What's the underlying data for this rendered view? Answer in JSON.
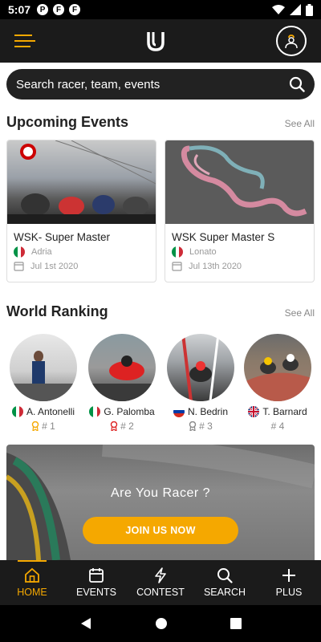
{
  "status_bar": {
    "time": "5:07",
    "app_icons": [
      "P",
      "F",
      "F"
    ]
  },
  "header": {
    "logo_icon": "u-logo-icon",
    "menu_icon": "hamburger-icon",
    "profile_icon": "user-icon"
  },
  "search": {
    "placeholder": "Search racer, team, events",
    "icon": "search-icon"
  },
  "upcoming": {
    "title": "Upcoming Events",
    "see_all": "See All",
    "events": [
      {
        "title": "WSK- Super Master",
        "location": "Adria",
        "date": "Jul 1st 2020"
      },
      {
        "title": "WSK Super Master S",
        "location": "Lonato",
        "date": "Jul 13th 2020"
      }
    ]
  },
  "ranking": {
    "title": "World Ranking",
    "see_all": "See All",
    "racers": [
      {
        "name": "A. Antonelli",
        "rank": "# 1",
        "flag": "italy"
      },
      {
        "name": "G. Palomba",
        "rank": "# 2",
        "flag": "italy"
      },
      {
        "name": "N. Bedrin",
        "rank": "# 3",
        "flag": "russia"
      },
      {
        "name": "T. Barnard",
        "rank": "# 4",
        "flag": "uk"
      }
    ]
  },
  "promo": {
    "title": "Are You Racer ?",
    "button": "JOIN US NOW"
  },
  "nav": {
    "items": [
      {
        "label": "HOME",
        "icon": "home-icon"
      },
      {
        "label": "EVENTS",
        "icon": "calendar-icon"
      },
      {
        "label": "CONTEST",
        "icon": "lightning-icon"
      },
      {
        "label": "SEARCH",
        "icon": "search-icon"
      },
      {
        "label": "PLUS",
        "icon": "plus-icon"
      }
    ]
  },
  "colors": {
    "accent": "#f5a800",
    "dark": "#1b1b1b"
  }
}
